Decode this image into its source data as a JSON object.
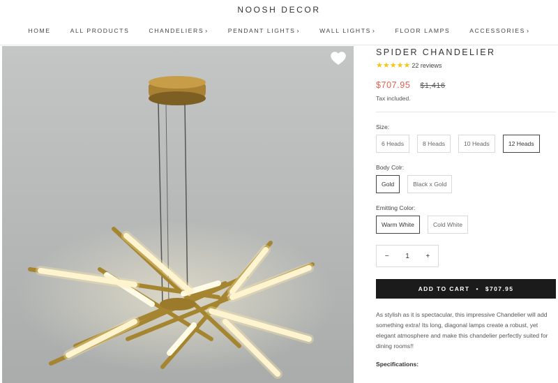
{
  "store": {
    "name": "NOOSH DECOR"
  },
  "nav": [
    {
      "label": "HOME",
      "chevron": false
    },
    {
      "label": "ALL PRODUCTS",
      "chevron": false
    },
    {
      "label": "CHANDELIERS",
      "chevron": true
    },
    {
      "label": "PENDANT LIGHTS",
      "chevron": true
    },
    {
      "label": "WALL LIGHTS",
      "chevron": true
    },
    {
      "label": "FLOOR LAMPS",
      "chevron": false
    },
    {
      "label": "ACCESSORIES",
      "chevron": true
    }
  ],
  "product": {
    "title": "SPIDER CHANDELIER",
    "stars": "★★★★★",
    "reviews": "22 reviews",
    "price": "$707.95",
    "compare_price": "$1,416",
    "tax_note": "Tax included.",
    "size_label": "Size:",
    "sizes": [
      "6 Heads",
      "8 Heads",
      "10 Heads",
      "12 Heads"
    ],
    "selected_size": "12 Heads",
    "body_color_label": "Body Colr:",
    "body_colors": [
      "Gold",
      "Black x Gold"
    ],
    "selected_body_color": "Gold",
    "emit_label": "Emitting Color:",
    "emit_colors": [
      "Warm White",
      "Cold White"
    ],
    "selected_emit_color": "Warm White",
    "quantity": "1",
    "minus": "−",
    "plus": "+",
    "cart_label": "ADD TO CART",
    "cart_separator": "•",
    "cart_price": "$707.95",
    "description": "As stylish as it is spectacular, this impressive Chandelier will add something extra! Its long, diagonal lamps create a robust, yet elegant atmosphere and make this chandelier perfectly suited for dining rooms!!",
    "specs_heading": "Specifications:"
  },
  "colors": {
    "price": "#e8604c",
    "stars": "#f5c518",
    "button": "#1b1b1b"
  },
  "icons": {
    "wishlist": "heart-icon",
    "nav_dropdown": "chevron-right-icon"
  }
}
